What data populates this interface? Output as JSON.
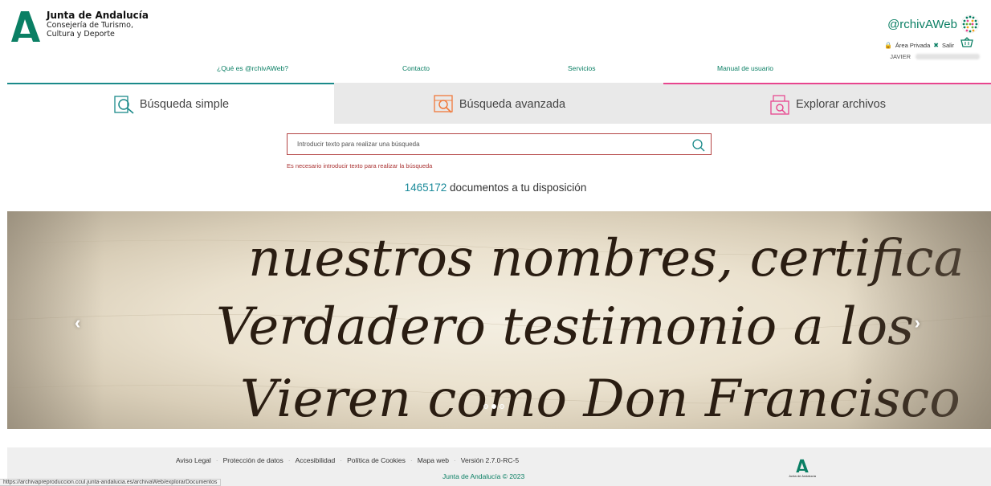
{
  "header": {
    "org_title": "Junta de Andalucía",
    "org_sub_1": "Consejería de Turismo,",
    "org_sub_2": "Cultura y Deporte",
    "brand": "@rchivAWeb",
    "private_area": "Área Privada",
    "logout": "Salir",
    "user": "JAVIER"
  },
  "nav": {
    "items": [
      "¿Qué es @rchivAWeb?",
      "Contacto",
      "Servicios",
      "Manual de usuario"
    ]
  },
  "tabs": {
    "simple": "Búsqueda simple",
    "advanced": "Búsqueda avanzada",
    "explore": "Explorar archivos"
  },
  "search": {
    "placeholder": "Introducir texto para realizar una búsqueda",
    "value": "",
    "error": "Es necesario introducir texto para realizar la búsqueda"
  },
  "stats": {
    "count": "1465172",
    "suffix": " documentos a tu disposición"
  },
  "carousel": {
    "script_lines": [
      "nuestros nombres, certifica",
      "Verdadero testimonio a los",
      "Vieren como Don Francisco"
    ],
    "prev": "‹",
    "next": "›"
  },
  "footer": {
    "links": [
      "Aviso Legal",
      "Protección de datos",
      "Accesibilidad",
      "Política de Cookies",
      "Mapa web",
      "Versión 2.7.0-RC-5"
    ],
    "separator": "·",
    "copyright": "Junta de Andalucía © 2023",
    "logo_caption": "Junta de Andalucía"
  },
  "statusbar": {
    "url": "https://archivapreproduccion.ccul.junta-andalucia.es/archivaWeb/explorarDocumentos"
  },
  "colors": {
    "green": "#0a7f64",
    "teal": "#1b8a8a",
    "pink": "#e8458e",
    "orange": "#f07a3c",
    "error_red": "#a33333"
  }
}
